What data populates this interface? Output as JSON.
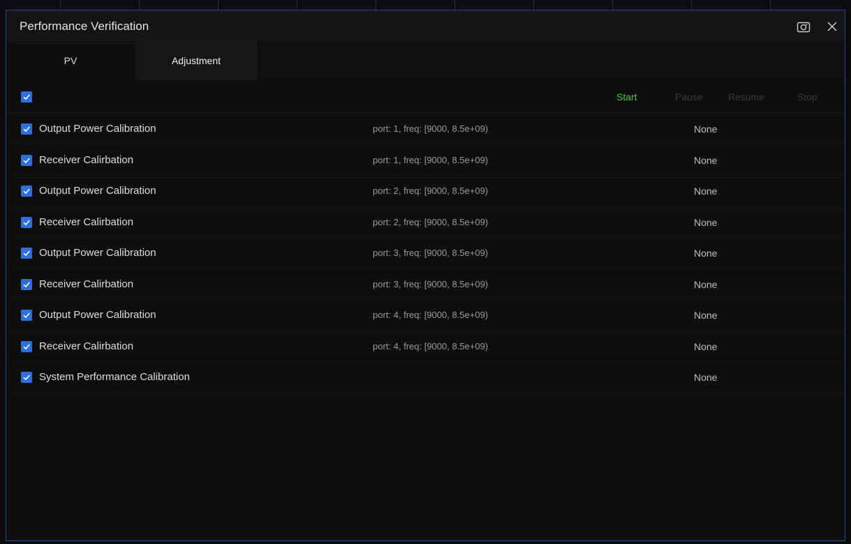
{
  "dialog": {
    "title": "Performance Verification"
  },
  "tabs": [
    {
      "label": "PV"
    },
    {
      "label": "Adjustment"
    }
  ],
  "toolbar": {
    "start": "Start",
    "pause": "Pause",
    "resume": "Resume",
    "stop": "Stop"
  },
  "colors": {
    "accent": "#2f6fd8",
    "start": "#3cc93c",
    "disabled": "#3a3a3d"
  },
  "rows": [
    {
      "name": "Output Power Calibration",
      "params": "port: 1, freq: [9000, 8.5e+09)",
      "result": "None",
      "checked": true
    },
    {
      "name": "Receiver Calirbation",
      "params": "port: 1, freq: [9000, 8.5e+09)",
      "result": "None",
      "checked": true
    },
    {
      "name": "Output Power Calibration",
      "params": "port: 2, freq: [9000, 8.5e+09)",
      "result": "None",
      "checked": true
    },
    {
      "name": "Receiver Calirbation",
      "params": "port: 2, freq: [9000, 8.5e+09)",
      "result": "None",
      "checked": true
    },
    {
      "name": "Output Power Calibration",
      "params": "port: 3, freq: [9000, 8.5e+09)",
      "result": "None",
      "checked": true
    },
    {
      "name": "Receiver Calirbation",
      "params": "port: 3, freq: [9000, 8.5e+09)",
      "result": "None",
      "checked": true
    },
    {
      "name": "Output Power Calibration",
      "params": "port: 4, freq: [9000, 8.5e+09)",
      "result": "None",
      "checked": true
    },
    {
      "name": "Receiver Calirbation",
      "params": "port: 4, freq: [9000, 8.5e+09)",
      "result": "None",
      "checked": true
    },
    {
      "name": "System Performance Calibration",
      "params": "",
      "result": "None",
      "checked": true
    }
  ]
}
